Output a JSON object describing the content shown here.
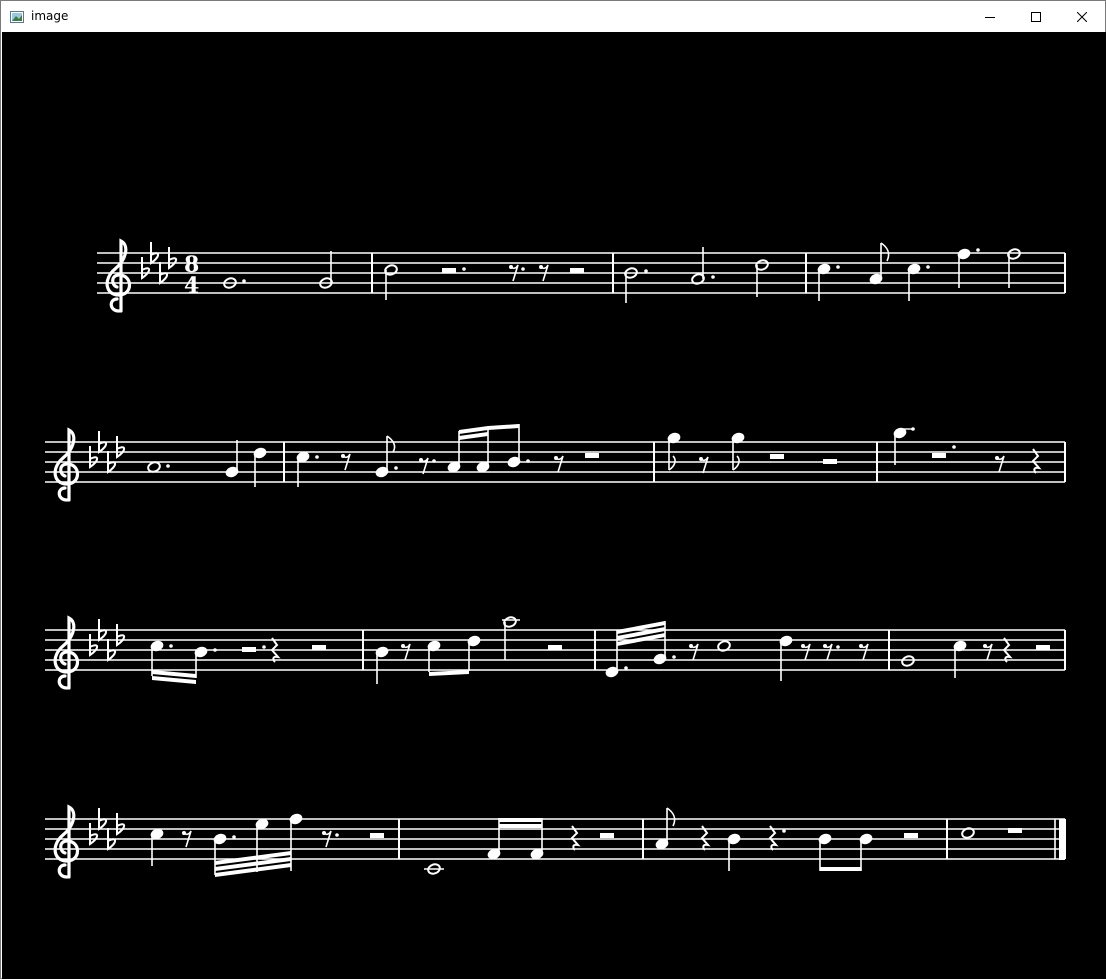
{
  "window": {
    "title": "image",
    "icons": {
      "app": "image-window-icon",
      "minimize": "minimize-icon",
      "maximize": "maximize-icon",
      "close": "close-icon"
    }
  },
  "colors": {
    "titlebar": "#ffffff",
    "canvas": "#000000",
    "ink": "#ffffff",
    "border": "#7a7a7a"
  },
  "score": {
    "description_visible": false,
    "clef": "treble",
    "key_signature_flats": 4,
    "time_signature": {
      "numerator": "8",
      "denominator": "4"
    },
    "systems": 4,
    "measures_per_system": [
      4,
      4,
      4,
      4
    ]
  }
}
